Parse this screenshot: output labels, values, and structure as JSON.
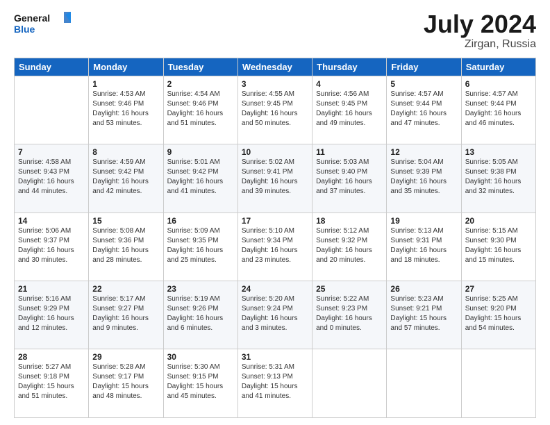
{
  "header": {
    "logo_line1": "General",
    "logo_line2": "Blue",
    "title": "July 2024",
    "subtitle": "Zirgan, Russia"
  },
  "weekdays": [
    "Sunday",
    "Monday",
    "Tuesday",
    "Wednesday",
    "Thursday",
    "Friday",
    "Saturday"
  ],
  "weeks": [
    [
      {
        "day": "",
        "info": ""
      },
      {
        "day": "1",
        "info": "Sunrise: 4:53 AM\nSunset: 9:46 PM\nDaylight: 16 hours\nand 53 minutes."
      },
      {
        "day": "2",
        "info": "Sunrise: 4:54 AM\nSunset: 9:46 PM\nDaylight: 16 hours\nand 51 minutes."
      },
      {
        "day": "3",
        "info": "Sunrise: 4:55 AM\nSunset: 9:45 PM\nDaylight: 16 hours\nand 50 minutes."
      },
      {
        "day": "4",
        "info": "Sunrise: 4:56 AM\nSunset: 9:45 PM\nDaylight: 16 hours\nand 49 minutes."
      },
      {
        "day": "5",
        "info": "Sunrise: 4:57 AM\nSunset: 9:44 PM\nDaylight: 16 hours\nand 47 minutes."
      },
      {
        "day": "6",
        "info": "Sunrise: 4:57 AM\nSunset: 9:44 PM\nDaylight: 16 hours\nand 46 minutes."
      }
    ],
    [
      {
        "day": "7",
        "info": "Sunrise: 4:58 AM\nSunset: 9:43 PM\nDaylight: 16 hours\nand 44 minutes."
      },
      {
        "day": "8",
        "info": "Sunrise: 4:59 AM\nSunset: 9:42 PM\nDaylight: 16 hours\nand 42 minutes."
      },
      {
        "day": "9",
        "info": "Sunrise: 5:01 AM\nSunset: 9:42 PM\nDaylight: 16 hours\nand 41 minutes."
      },
      {
        "day": "10",
        "info": "Sunrise: 5:02 AM\nSunset: 9:41 PM\nDaylight: 16 hours\nand 39 minutes."
      },
      {
        "day": "11",
        "info": "Sunrise: 5:03 AM\nSunset: 9:40 PM\nDaylight: 16 hours\nand 37 minutes."
      },
      {
        "day": "12",
        "info": "Sunrise: 5:04 AM\nSunset: 9:39 PM\nDaylight: 16 hours\nand 35 minutes."
      },
      {
        "day": "13",
        "info": "Sunrise: 5:05 AM\nSunset: 9:38 PM\nDaylight: 16 hours\nand 32 minutes."
      }
    ],
    [
      {
        "day": "14",
        "info": "Sunrise: 5:06 AM\nSunset: 9:37 PM\nDaylight: 16 hours\nand 30 minutes."
      },
      {
        "day": "15",
        "info": "Sunrise: 5:08 AM\nSunset: 9:36 PM\nDaylight: 16 hours\nand 28 minutes."
      },
      {
        "day": "16",
        "info": "Sunrise: 5:09 AM\nSunset: 9:35 PM\nDaylight: 16 hours\nand 25 minutes."
      },
      {
        "day": "17",
        "info": "Sunrise: 5:10 AM\nSunset: 9:34 PM\nDaylight: 16 hours\nand 23 minutes."
      },
      {
        "day": "18",
        "info": "Sunrise: 5:12 AM\nSunset: 9:32 PM\nDaylight: 16 hours\nand 20 minutes."
      },
      {
        "day": "19",
        "info": "Sunrise: 5:13 AM\nSunset: 9:31 PM\nDaylight: 16 hours\nand 18 minutes."
      },
      {
        "day": "20",
        "info": "Sunrise: 5:15 AM\nSunset: 9:30 PM\nDaylight: 16 hours\nand 15 minutes."
      }
    ],
    [
      {
        "day": "21",
        "info": "Sunrise: 5:16 AM\nSunset: 9:29 PM\nDaylight: 16 hours\nand 12 minutes."
      },
      {
        "day": "22",
        "info": "Sunrise: 5:17 AM\nSunset: 9:27 PM\nDaylight: 16 hours\nand 9 minutes."
      },
      {
        "day": "23",
        "info": "Sunrise: 5:19 AM\nSunset: 9:26 PM\nDaylight: 16 hours\nand 6 minutes."
      },
      {
        "day": "24",
        "info": "Sunrise: 5:20 AM\nSunset: 9:24 PM\nDaylight: 16 hours\nand 3 minutes."
      },
      {
        "day": "25",
        "info": "Sunrise: 5:22 AM\nSunset: 9:23 PM\nDaylight: 16 hours\nand 0 minutes."
      },
      {
        "day": "26",
        "info": "Sunrise: 5:23 AM\nSunset: 9:21 PM\nDaylight: 15 hours\nand 57 minutes."
      },
      {
        "day": "27",
        "info": "Sunrise: 5:25 AM\nSunset: 9:20 PM\nDaylight: 15 hours\nand 54 minutes."
      }
    ],
    [
      {
        "day": "28",
        "info": "Sunrise: 5:27 AM\nSunset: 9:18 PM\nDaylight: 15 hours\nand 51 minutes."
      },
      {
        "day": "29",
        "info": "Sunrise: 5:28 AM\nSunset: 9:17 PM\nDaylight: 15 hours\nand 48 minutes."
      },
      {
        "day": "30",
        "info": "Sunrise: 5:30 AM\nSunset: 9:15 PM\nDaylight: 15 hours\nand 45 minutes."
      },
      {
        "day": "31",
        "info": "Sunrise: 5:31 AM\nSunset: 9:13 PM\nDaylight: 15 hours\nand 41 minutes."
      },
      {
        "day": "",
        "info": ""
      },
      {
        "day": "",
        "info": ""
      },
      {
        "day": "",
        "info": ""
      }
    ]
  ]
}
